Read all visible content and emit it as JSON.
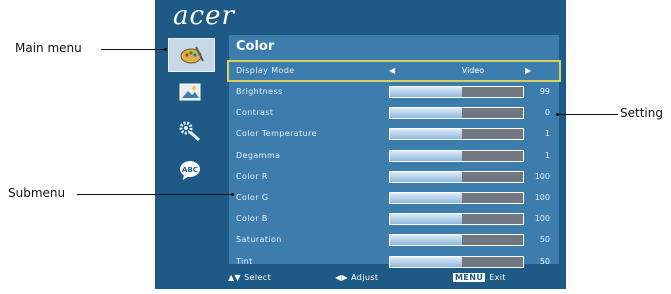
{
  "brand": "acer",
  "menu_title": "Color",
  "display_mode": {
    "label": "Display Mode",
    "value": "Video"
  },
  "settings": [
    {
      "label": "Brightness",
      "value": "99",
      "level": 0.54
    },
    {
      "label": "Contrast",
      "value": "0",
      "level": 0.54
    },
    {
      "label": "Color Temperature",
      "value": "1",
      "level": 0.54
    },
    {
      "label": "Degamma",
      "value": "1",
      "level": 0.54
    },
    {
      "label": "Color R",
      "value": "100",
      "level": 0.54
    },
    {
      "label": "Color G",
      "value": "100",
      "level": 0.54
    },
    {
      "label": "Color B",
      "value": "100",
      "level": 0.54
    },
    {
      "label": "Saturation",
      "value": "50",
      "level": 0.54
    },
    {
      "label": "Tint",
      "value": "50",
      "level": 0.54
    }
  ],
  "footer": {
    "select": "Select",
    "adjust": "Adjust",
    "menu_badge": "MENU",
    "exit": "Exit"
  },
  "callouts": {
    "main_menu": "Main menu",
    "submenu": "Submenu",
    "setting": "Setting"
  },
  "sidebar_icons": [
    "color-palette-icon",
    "image-icon",
    "settings-tools-icon",
    "language-abc-icon"
  ],
  "colors": {
    "osd_bg": "#1f5a86",
    "panel_bg": "#3d7dae",
    "selection": "#d8cf62",
    "bar_fill": "#b9d4ec"
  }
}
